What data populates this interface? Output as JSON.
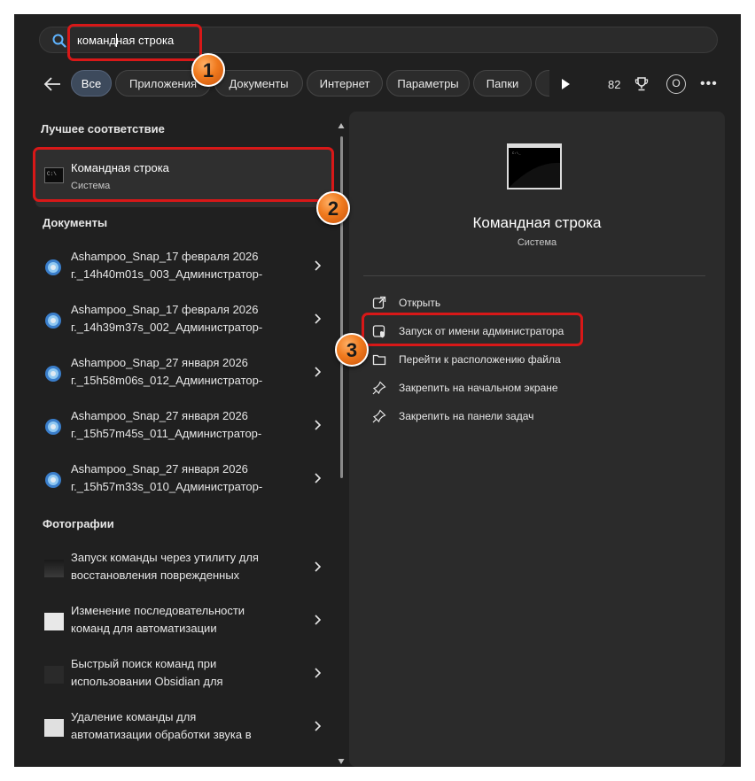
{
  "search": {
    "value_typed": "команд",
    "value_rest": "ная строка"
  },
  "filters": {
    "chips": [
      "Все",
      "Приложения",
      "Документы",
      "Интернет",
      "Параметры",
      "Папки"
    ],
    "points": "82",
    "avatar_letter": "O",
    "more": "•••"
  },
  "left": {
    "best_match_title": "Лучшее соответствие",
    "best_match": {
      "name": "Командная строка",
      "type": "Система"
    },
    "documents_title": "Документы",
    "documents": [
      {
        "line1": "Ashampoo_Snap_17 февраля 2026",
        "line2": "г._14h40m01s_003_Администратор-"
      },
      {
        "line1": "Ashampoo_Snap_17 февраля 2026",
        "line2": "г._14h39m37s_002_Администратор-"
      },
      {
        "line1": "Ashampoo_Snap_27 января 2026",
        "line2": "г._15h58m06s_012_Администратор-"
      },
      {
        "line1": "Ashampoo_Snap_27 января 2026",
        "line2": "г._15h57m45s_011_Администратор-"
      },
      {
        "line1": "Ashampoo_Snap_27 января 2026",
        "line2": "г._15h57m33s_010_Администратор-"
      }
    ],
    "photos_title": "Фотографии",
    "photos": [
      {
        "line1": "Запуск команды через утилиту для",
        "line2": "восстановления поврежденных"
      },
      {
        "line1": "Изменение последовательности",
        "line2": "команд для автоматизации"
      },
      {
        "line1": "Быстрый поиск команд при",
        "line2": "использовании Obsidian для"
      },
      {
        "line1": "Удаление команды для",
        "line2": "автоматизации обработки звука в"
      }
    ]
  },
  "right": {
    "app_name": "Командная строка",
    "app_type": "Система",
    "actions": [
      "Открыть",
      "Запуск от имени администратора",
      "Перейти к расположению файла",
      "Закрепить на начальном экране",
      "Закрепить на панели задач"
    ]
  },
  "annotations": {
    "step1": "1",
    "step2": "2",
    "step3": "3"
  },
  "colors": {
    "highlight": "#d81818",
    "badge": "#f07a1e",
    "panel": "#2b2b2b",
    "background": "#202020"
  }
}
